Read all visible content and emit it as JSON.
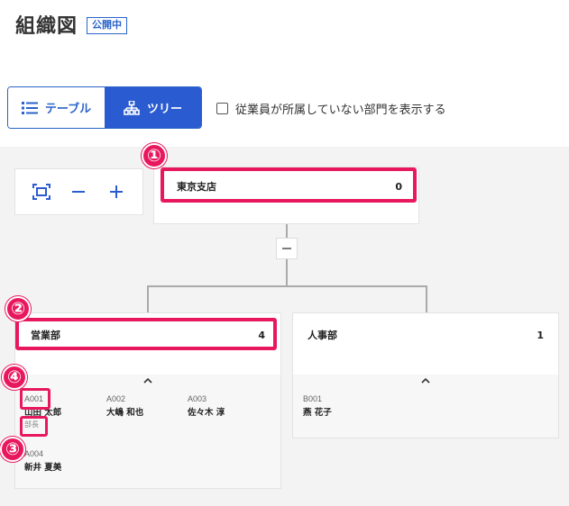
{
  "header": {
    "title": "組織図",
    "status_badge": "公開中"
  },
  "view_toggle": {
    "table_label": "テーブル",
    "tree_label": "ツリー",
    "active": "tree"
  },
  "filter": {
    "show_empty_departments_label": "従業員が所属していない部門を表示する",
    "checked": false
  },
  "zoom_controls": [
    "fit-screen-icon",
    "minus-icon",
    "plus-icon"
  ],
  "tree": {
    "root": {
      "name": "東京支店",
      "count": "0"
    },
    "departments": [
      {
        "name": "営業部",
        "count": "4",
        "employees": [
          {
            "code": "A001",
            "name": "山田 太郎",
            "role": "部長"
          },
          {
            "code": "A002",
            "name": "大嶋 和也",
            "role": ""
          },
          {
            "code": "A003",
            "name": "佐々木 淳",
            "role": ""
          },
          {
            "code": "A004",
            "name": "新井 夏美",
            "role": ""
          }
        ]
      },
      {
        "name": "人事部",
        "count": "1",
        "employees": [
          {
            "code": "B001",
            "name": "燕 花子",
            "role": ""
          }
        ]
      }
    ]
  },
  "callouts": [
    "①",
    "②",
    "③",
    "④"
  ],
  "colors": {
    "accent": "#2a5bd0",
    "highlight": "#e8185f",
    "canvas": "#f4f3f3"
  }
}
